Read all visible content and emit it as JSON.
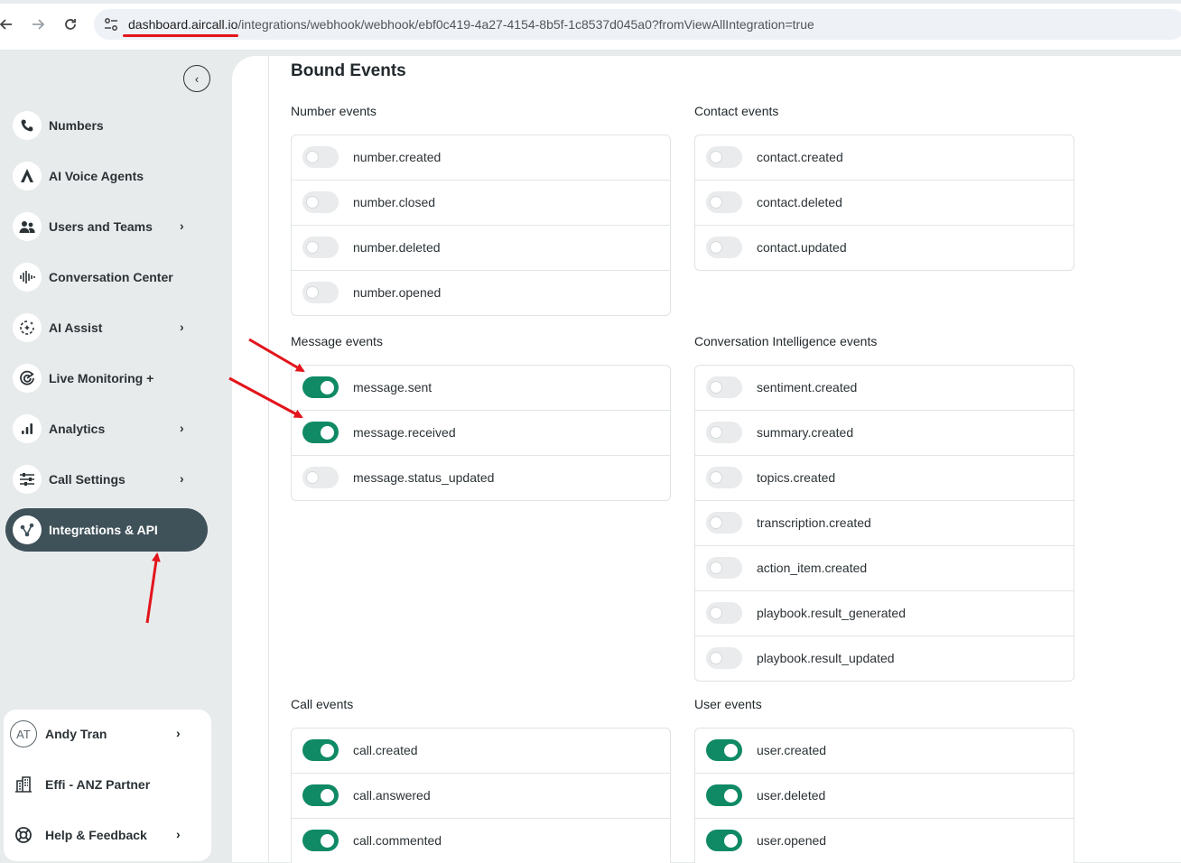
{
  "browser": {
    "url_host": "dashboard.aircall.io",
    "url_path": "/integrations/webhook/webhook/ebf0c419-4a27-4154-8b5f-1c8537d045a0?fromViewAllIntegration=true"
  },
  "sidebar": {
    "items": [
      {
        "label": "Numbers",
        "icon": "phone-icon",
        "chevron": false
      },
      {
        "label": "AI Voice Agents",
        "icon": "ai-voice-agents-icon",
        "chevron": false
      },
      {
        "label": "Users and Teams",
        "icon": "users-icon",
        "chevron": true
      },
      {
        "label": "Conversation Center",
        "icon": "waveform-icon",
        "chevron": false
      },
      {
        "label": "AI Assist",
        "icon": "sparkle-icon",
        "chevron": true
      },
      {
        "label": "Live Monitoring +",
        "icon": "radar-icon",
        "chevron": false
      },
      {
        "label": "Analytics",
        "icon": "bar-chart-icon",
        "chevron": true
      },
      {
        "label": "Call Settings",
        "icon": "sliders-icon",
        "chevron": true
      },
      {
        "label": "Integrations & API",
        "icon": "integrations-icon",
        "chevron": false,
        "active": true
      }
    ],
    "chevron_glyph": "›",
    "collapse_glyph": "‹",
    "account": {
      "avatar_initials": "AT",
      "name": "Andy Tran",
      "company": "Effi - ANZ Partner",
      "help": "Help & Feedback"
    }
  },
  "main": {
    "title": "Bound Events",
    "sections": {
      "number": {
        "label": "Number events",
        "events": [
          {
            "name": "number.created",
            "enabled": false
          },
          {
            "name": "number.closed",
            "enabled": false
          },
          {
            "name": "number.deleted",
            "enabled": false
          },
          {
            "name": "number.opened",
            "enabled": false
          }
        ]
      },
      "contact": {
        "label": "Contact events",
        "events": [
          {
            "name": "contact.created",
            "enabled": false
          },
          {
            "name": "contact.deleted",
            "enabled": false
          },
          {
            "name": "contact.updated",
            "enabled": false
          }
        ]
      },
      "message": {
        "label": "Message events",
        "events": [
          {
            "name": "message.sent",
            "enabled": true
          },
          {
            "name": "message.received",
            "enabled": true
          },
          {
            "name": "message.status_updated",
            "enabled": false
          }
        ]
      },
      "ci": {
        "label": "Conversation Intelligence events",
        "events": [
          {
            "name": "sentiment.created",
            "enabled": false
          },
          {
            "name": "summary.created",
            "enabled": false
          },
          {
            "name": "topics.created",
            "enabled": false
          },
          {
            "name": "transcription.created",
            "enabled": false
          },
          {
            "name": "action_item.created",
            "enabled": false
          },
          {
            "name": "playbook.result_generated",
            "enabled": false
          },
          {
            "name": "playbook.result_updated",
            "enabled": false
          }
        ]
      },
      "call": {
        "label": "Call events",
        "events": [
          {
            "name": "call.created",
            "enabled": true
          },
          {
            "name": "call.answered",
            "enabled": true
          },
          {
            "name": "call.commented",
            "enabled": true
          }
        ]
      },
      "user": {
        "label": "User events",
        "events": [
          {
            "name": "user.created",
            "enabled": true
          },
          {
            "name": "user.deleted",
            "enabled": true
          },
          {
            "name": "user.opened",
            "enabled": true
          }
        ]
      }
    }
  },
  "colors": {
    "toggle_on": "#0f8a65",
    "active_nav": "#3f5159",
    "annotation": "#e3141b"
  }
}
